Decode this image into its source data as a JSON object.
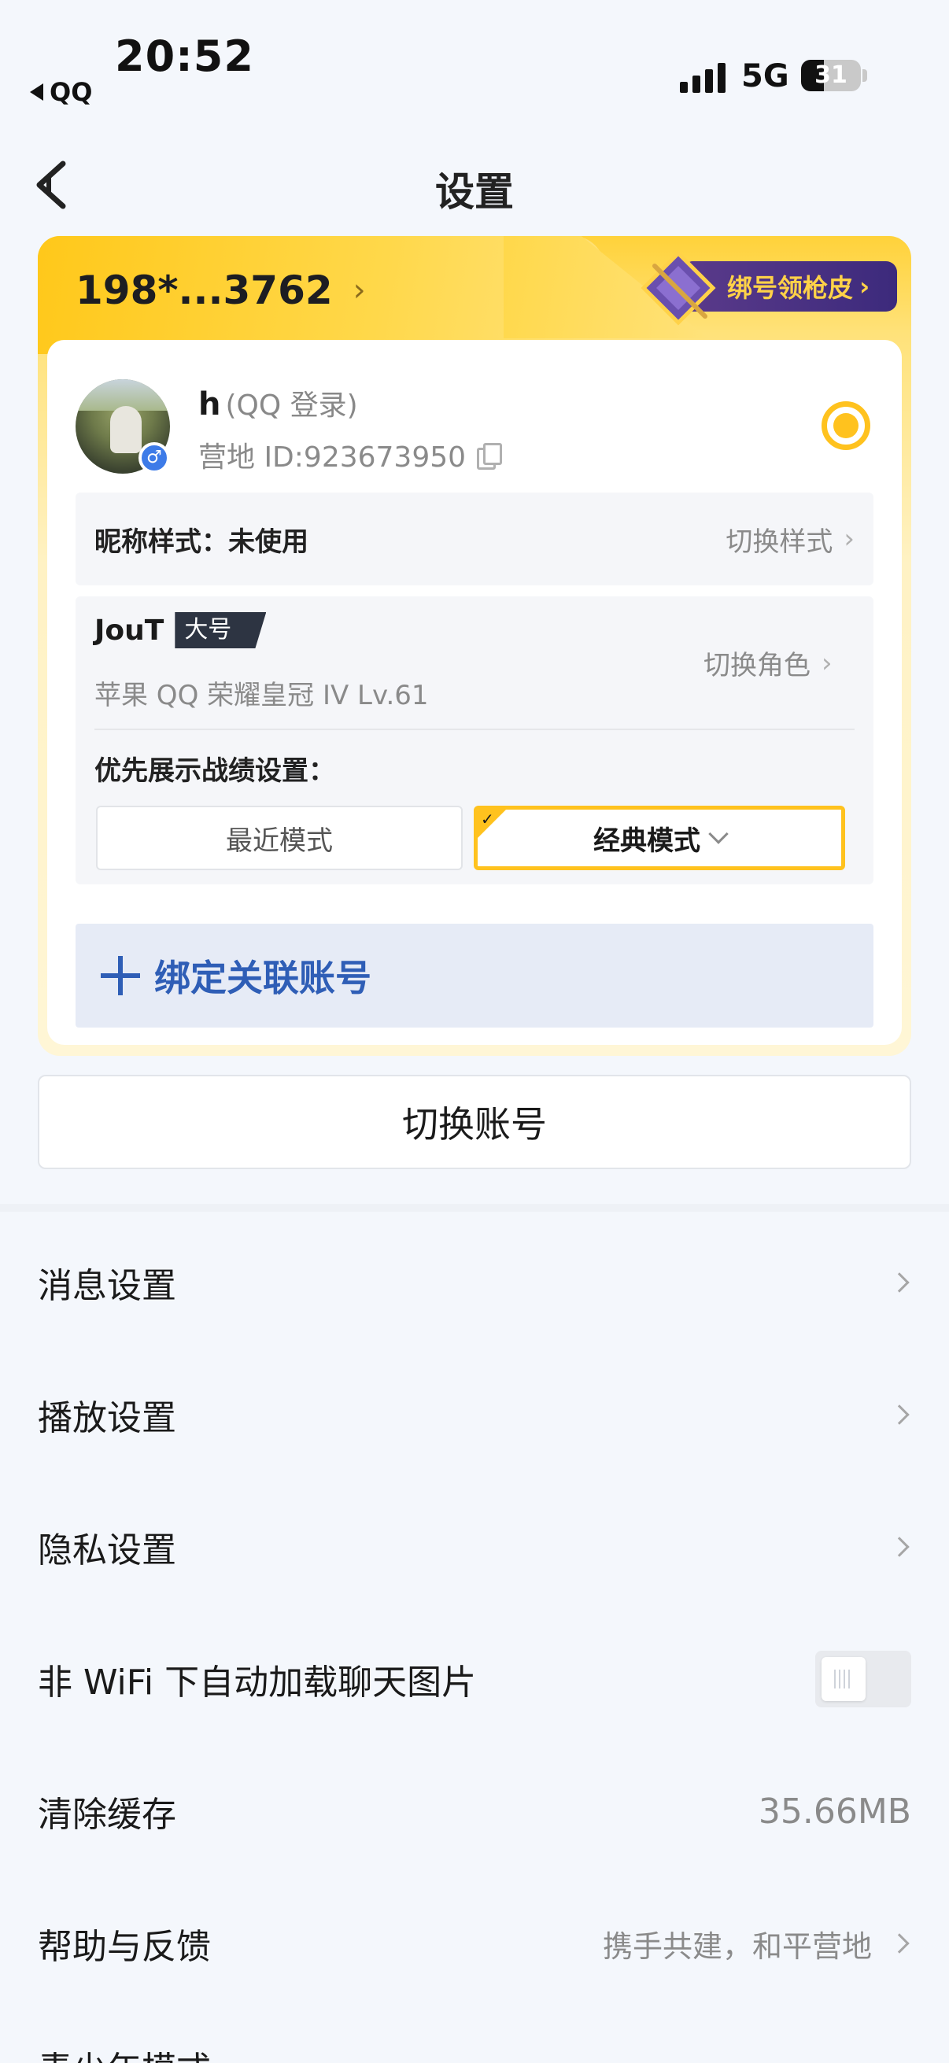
{
  "status_bar": {
    "time": "20:52",
    "back_app": "QQ",
    "network": "5G",
    "battery": "31"
  },
  "nav": {
    "title": "设置"
  },
  "account": {
    "masked_number": "198*...3762",
    "promo_label": "绑号领枪皮",
    "nickname": "h",
    "login_type": "(QQ 登录)",
    "camp_id": "营地 ID:923673950",
    "nickname_style_label": "昵称样式：未使用",
    "nickname_style_action": "切换样式",
    "role": {
      "name": "JouT",
      "tag": "大号",
      "meta": "苹果 QQ  荣耀皇冠 IV  Lv.61",
      "switch_label": "切换角色"
    },
    "priority_label": "优先展示战绩设置：",
    "modes": {
      "recent": "最近模式",
      "classic": "经典模式"
    },
    "bind_label": "绑定关联账号"
  },
  "switch_account_label": "切换账号",
  "menu": {
    "message": "消息设置",
    "playback": "播放设置",
    "privacy": "隐私设置",
    "auto_load": "非 WiFi 下自动加载聊天图片",
    "auto_load_on": false,
    "clear_cache": "清除缓存",
    "cache_size": "35.66MB",
    "help": "帮助与反馈",
    "help_hint": "携手共建，和平营地",
    "cutoff": "青少年模式"
  },
  "colors": {
    "accent_yellow": "#ffc21e",
    "link_blue": "#2f5eb6",
    "background": "#f4f7fc"
  }
}
